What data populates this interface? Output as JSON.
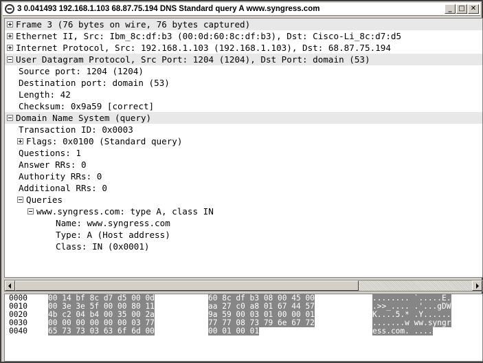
{
  "window": {
    "title": "3 0.041493 192.168.1.103 68.87.75.194 DNS Standard query A www.syngress.com",
    "min_label": "_",
    "max_label": "□",
    "close_label": "✕"
  },
  "tree": [
    {
      "text": "Frame 3 (76 bytes on wire, 76 bytes captured)",
      "indent": 0,
      "expander": "plus",
      "shaded": true
    },
    {
      "text": "Ethernet II, Src: Ibm_8c:df:b3 (00:0d:60:8c:df:b3), Dst: Cisco-Li_8c:d7:d5",
      "indent": 0,
      "expander": "plus",
      "shaded": false
    },
    {
      "text": "Internet Protocol, Src: 192.168.1.103 (192.168.1.103), Dst: 68.87.75.194",
      "indent": 0,
      "expander": "plus",
      "shaded": false
    },
    {
      "text": "User Datagram Protocol, Src Port: 1204 (1204), Dst Port: domain (53)",
      "indent": 0,
      "expander": "minus",
      "shaded": true
    },
    {
      "text": "Source port: 1204 (1204)",
      "indent": 1,
      "expander": "none",
      "shaded": false
    },
    {
      "text": "Destination port: domain (53)",
      "indent": 1,
      "expander": "none",
      "shaded": false
    },
    {
      "text": "Length: 42",
      "indent": 1,
      "expander": "none",
      "shaded": false
    },
    {
      "text": "Checksum: 0x9a59 [correct]",
      "indent": 1,
      "expander": "none",
      "shaded": false
    },
    {
      "text": "Domain Name System (query)",
      "indent": 0,
      "expander": "minus",
      "shaded": true
    },
    {
      "text": "Transaction ID: 0x0003",
      "indent": 1,
      "expander": "none",
      "shaded": false
    },
    {
      "text": "Flags: 0x0100 (Standard query)",
      "indent": 1,
      "expander": "plus",
      "shaded": false
    },
    {
      "text": "Questions: 1",
      "indent": 1,
      "expander": "none",
      "shaded": false
    },
    {
      "text": "Answer RRs: 0",
      "indent": 1,
      "expander": "none",
      "shaded": false
    },
    {
      "text": "Authority RRs: 0",
      "indent": 1,
      "expander": "none",
      "shaded": false
    },
    {
      "text": "Additional RRs: 0",
      "indent": 1,
      "expander": "none",
      "shaded": false
    },
    {
      "text": "Queries",
      "indent": 1,
      "expander": "minus",
      "shaded": false
    },
    {
      "text": "www.syngress.com: type A, class IN",
      "indent": 2,
      "expander": "minus",
      "shaded": false
    },
    {
      "text": "Name: www.syngress.com",
      "indent": 3,
      "expander": "none",
      "shaded": false
    },
    {
      "text": "Type: A (Host address)",
      "indent": 3,
      "expander": "none",
      "shaded": false
    },
    {
      "text": "Class: IN (0x0001)",
      "indent": 3,
      "expander": "none",
      "shaded": false
    }
  ],
  "hex": [
    {
      "offset": "0000",
      "g1": "00 14 bf 8c d7 d5 00 0d",
      "g2": "60 8c df b3 08 00 45 00",
      "ascii": "........ `.....E."
    },
    {
      "offset": "0010",
      "g1": "00 3e 3e 5f 00 00 80 11",
      "g2": "aa 27 c0 a8 01 67 44 57",
      "ascii": ".>>_.... .'...gDW"
    },
    {
      "offset": "0020",
      "g1": "4b c2 04 b4 00 35 00 2a",
      "g2": "9a 59 00 03 01 00 00 01",
      "ascii": "K....5.* .Y......"
    },
    {
      "offset": "0030",
      "g1": "00 00 00 00 00 00 03 77",
      "g2": "77 77 08 73 79 6e 67 72",
      "ascii": ".......w ww.syngr"
    },
    {
      "offset": "0040",
      "g1": "65 73 73 03 63 6f 6d 00",
      "g2": "00 01 00 01",
      "ascii": "ess.com. ...."
    }
  ],
  "colors": {
    "selection_bg": "#868686",
    "shaded_row": "#e8e8e8",
    "window_frame": "#d4d0c8"
  }
}
